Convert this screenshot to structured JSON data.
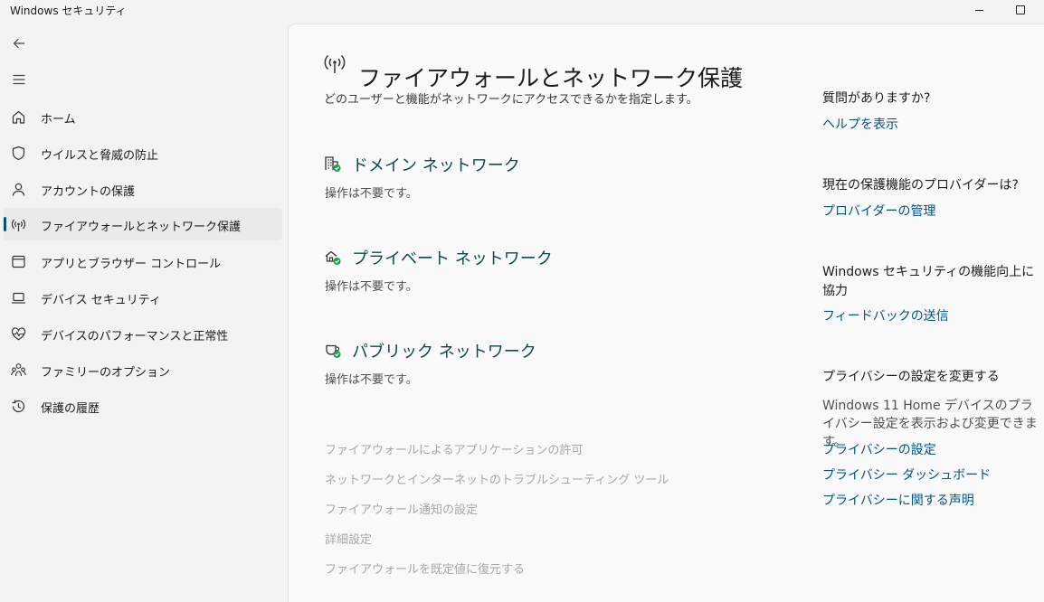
{
  "window": {
    "title": "Windows セキュリティ"
  },
  "sidebar": {
    "items": [
      {
        "label": "ホーム",
        "icon": "home-icon"
      },
      {
        "label": "ウイルスと脅威の防止",
        "icon": "shield-icon"
      },
      {
        "label": "アカウントの保護",
        "icon": "person-icon"
      },
      {
        "label": "ファイアウォールとネットワーク保護",
        "icon": "antenna-icon",
        "selected": true
      },
      {
        "label": "アプリとブラウザー コントロール",
        "icon": "app-browser-icon"
      },
      {
        "label": "デバイス セキュリティ",
        "icon": "laptop-icon"
      },
      {
        "label": "デバイスのパフォーマンスと正常性",
        "icon": "heart-pulse-icon"
      },
      {
        "label": "ファミリーのオプション",
        "icon": "family-icon"
      },
      {
        "label": "保護の履歴",
        "icon": "history-icon"
      }
    ]
  },
  "main": {
    "title": "ファイアウォールとネットワーク保護",
    "description": "どのユーザーと機能がネットワークにアクセスできるかを指定します。",
    "networks": [
      {
        "name": "ドメイン ネットワーク",
        "status": "操作は不要です。",
        "icon": "domain-network-icon"
      },
      {
        "name": "プライベート ネットワーク",
        "status": "操作は不要です。",
        "icon": "private-network-icon"
      },
      {
        "name": "パブリック ネットワーク",
        "status": "操作は不要です。",
        "icon": "public-network-icon"
      }
    ],
    "links": [
      "ファイアウォールによるアプリケーションの許可",
      "ネットワークとインターネットのトラブルシューティング ツール",
      "ファイアウォール通知の設定",
      "詳細設定",
      "ファイアウォールを既定値に復元する"
    ]
  },
  "aside": {
    "help_heading": "質問がありますか?",
    "help_link": "ヘルプを表示",
    "provider_heading": "現在の保護機能のプロバイダーは?",
    "provider_link": "プロバイダーの管理",
    "improve_heading": "Windows セキュリティの機能向上に協力",
    "feedback_link": "フィードバックの送信",
    "privacy_heading": "プライバシーの設定を変更する",
    "privacy_text": "Windows 11 Home デバイスのプライバシー設定を表示および変更できます。",
    "privacy_links": [
      "プライバシーの設定",
      "プライバシー ダッシュボード",
      "プライバシーに関する声明"
    ]
  },
  "colors": {
    "accent": "#00548a",
    "ok_green": "#16a34a",
    "disabled": "#a7a7a7"
  }
}
